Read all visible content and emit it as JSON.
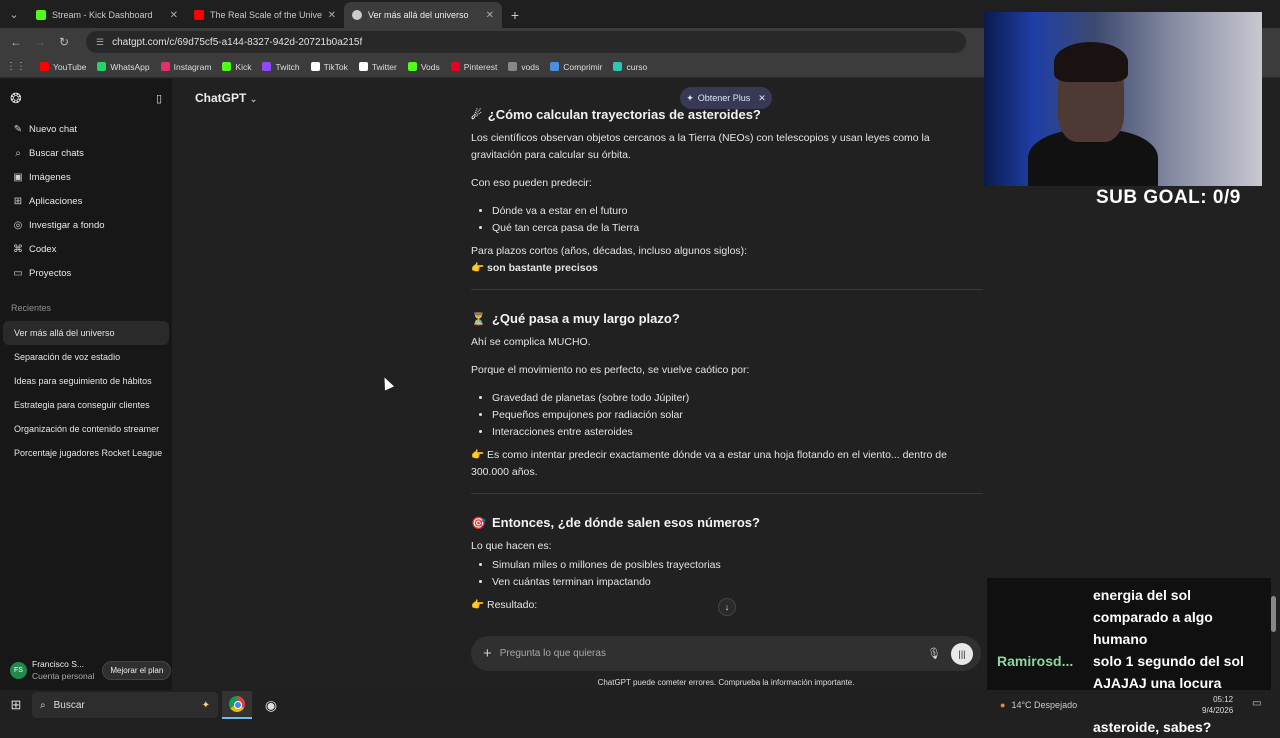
{
  "browser": {
    "tabs": [
      {
        "title": "Stream - Kick Dashboard",
        "color": "#53fc18"
      },
      {
        "title": "The Real Scale of the Universe",
        "color": "#ff0000"
      },
      {
        "title": "Ver más allá del universo",
        "color": "#cccccc"
      }
    ],
    "url": "chatgpt.com/c/69d75cf5-a144-8327-942d-20721b0a215f",
    "bookmarks": [
      {
        "label": "YouTube",
        "color": "#ff0000"
      },
      {
        "label": "WhatsApp",
        "color": "#25d366"
      },
      {
        "label": "Instagram",
        "color": "#e1306c"
      },
      {
        "label": "Kick",
        "color": "#53fc18"
      },
      {
        "label": "Twitch",
        "color": "#9146ff"
      },
      {
        "label": "TikTok",
        "color": "#ffffff"
      },
      {
        "label": "Twitter",
        "color": "#ffffff"
      },
      {
        "label": "Vods",
        "color": "#53fc18"
      },
      {
        "label": "Pinterest",
        "color": "#e60023"
      },
      {
        "label": "vods",
        "color": "#888888"
      },
      {
        "label": "Comprimir",
        "color": "#4a90e2"
      },
      {
        "label": "curso",
        "color": "#2ec4b6"
      }
    ]
  },
  "sidebar": {
    "nav": [
      {
        "label": "Nuevo chat",
        "icon": "✎"
      },
      {
        "label": "Buscar chats",
        "icon": "⌕"
      },
      {
        "label": "Imágenes",
        "icon": "▣"
      },
      {
        "label": "Aplicaciones",
        "icon": "⊞"
      },
      {
        "label": "Investigar a fondo",
        "icon": "◎"
      },
      {
        "label": "Codex",
        "icon": "⌘"
      },
      {
        "label": "Proyectos",
        "icon": "▭"
      }
    ],
    "section_label": "Recientes",
    "chats": [
      "Ver más allá del universo",
      "Separación de voz estadio",
      "Ideas para seguimiento de hábitos",
      "Estrategia para conseguir clientes",
      "Organización de contenido streamer",
      "Porcentaje jugadores Rocket League"
    ],
    "user": {
      "initials": "FS",
      "name": "Francisco S...",
      "plan": "Cuenta personal",
      "upgrade": "Mejorar el plan"
    }
  },
  "main": {
    "model": "ChatGPT",
    "plus_pill": "Obtener Plus",
    "s1": {
      "title": "¿Cómo calculan trayectorias de asteroides?",
      "p1": "Los científicos observan objetos cercanos a la Tierra (NEOs) con telescopios y usan leyes como la gravitación para calcular su órbita.",
      "p2": "Con eso pueden predecir:",
      "items": [
        "Dónde va a estar en el futuro",
        "Qué tan cerca pasa de la Tierra"
      ],
      "p3": "Para plazos cortos (años, décadas, incluso algunos siglos):",
      "p4": "son bastante precisos"
    },
    "s2": {
      "title": "¿Qué pasa a muy largo plazo?",
      "p1": "Ahí se complica MUCHO.",
      "p2": "Porque el movimiento no es perfecto, se vuelve caótico por:",
      "items": [
        "Gravedad de planetas (sobre todo Júpiter)",
        "Pequeños empujones por radiación solar",
        "Interacciones entre asteroides"
      ],
      "p3": "Es como intentar predecir exactamente dónde va a estar una hoja flotando en el viento... dentro de 300.000 años."
    },
    "s3": {
      "title": "Entonces, ¿de dónde salen esos números?",
      "p1": "Lo que hacen es:",
      "items": [
        "Simulan miles o millones de posibles trayectorias",
        "Ven cuántas terminan impactando"
      ],
      "p2": "Resultado:"
    },
    "composer_placeholder": "Pregunta lo que quieras",
    "disclaimer": "ChatGPT puede cometer errores. Comprueba la información importante."
  },
  "stream": {
    "subgoal": "SUB GOAL: 0/9",
    "chat": [
      {
        "user": "",
        "text": "energia del sol comparado a algo humano"
      },
      {
        "user": "Ramirosd...",
        "text": "solo 1 segundo del sol AJAJAJ una locura"
      },
      {
        "user": "Ramirosd...",
        "text": "donde cayo ese asteroide, sabes?"
      }
    ]
  },
  "taskbar": {
    "search": "Buscar",
    "weather": "14°C  Despejado",
    "time": "05:12",
    "date": "9/4/2026"
  }
}
